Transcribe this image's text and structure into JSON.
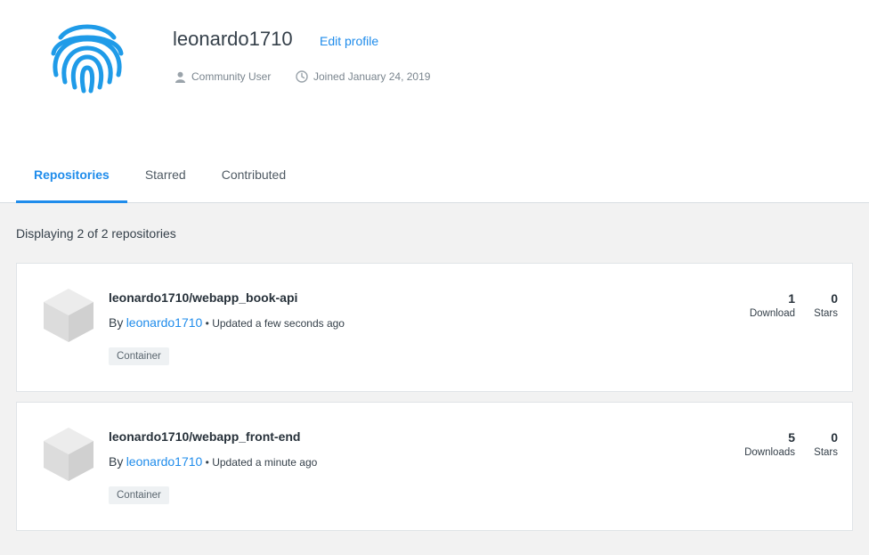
{
  "profile": {
    "username": "leonardo1710",
    "edit_label": "Edit profile",
    "role": "Community User",
    "joined": "Joined January 24, 2019",
    "brand_color": "#1f8ceb"
  },
  "tabs": [
    {
      "label": "Repositories",
      "active": true
    },
    {
      "label": "Starred",
      "active": false
    },
    {
      "label": "Contributed",
      "active": false
    }
  ],
  "listing": {
    "count_text": "Displaying 2 of 2 repositories"
  },
  "repositories": [
    {
      "name": "leonardo1710/webapp_book-api",
      "by": "By",
      "owner": "leonardo1710",
      "updated": "• Updated a few seconds ago",
      "badge": "Container",
      "downloads": "1",
      "downloads_label": "Download",
      "stars": "0",
      "stars_label": "Stars"
    },
    {
      "name": "leonardo1710/webapp_front-end",
      "by": "By",
      "owner": "leonardo1710",
      "updated": "• Updated a minute ago",
      "badge": "Container",
      "downloads": "5",
      "downloads_label": "Downloads",
      "stars": "0",
      "stars_label": "Stars"
    }
  ]
}
